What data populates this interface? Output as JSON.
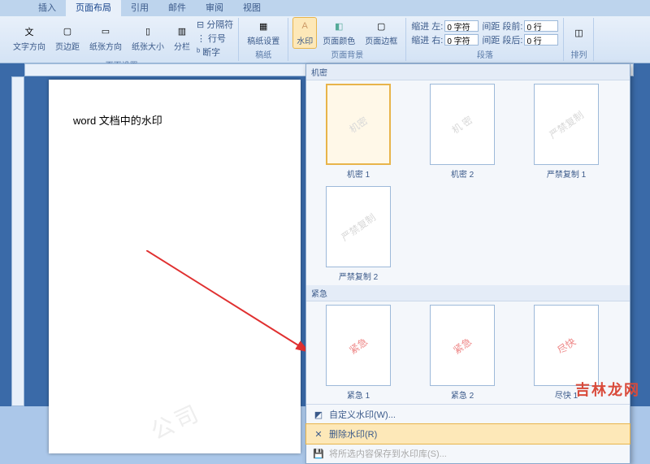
{
  "tabs": {
    "t1": "插入",
    "t2": "页面布局",
    "t3": "引用",
    "t4": "邮件",
    "t5": "审阅",
    "t6": "视图"
  },
  "ribbon": {
    "pageSetup": {
      "label": "页面设置",
      "textDir": "文字方向",
      "margins": "页边距",
      "orient": "纸张方向",
      "size": "纸张大小",
      "columns": "分栏",
      "breaks": "分隔符",
      "lineNum": "行号",
      "hyphen": "断字"
    },
    "paper": {
      "label": "稿纸",
      "btn": "稿纸设置"
    },
    "pageBg": {
      "label": "页面背景",
      "watermark": "水印",
      "pageColor": "页面颜色",
      "borders": "页面边框"
    },
    "paragraph": {
      "label": "段落",
      "indentL": "缩进 左:",
      "indentR": "缩进 右:",
      "spaceB": "间距 段前:",
      "spaceA": "间距 段后:",
      "zeroChar": "0 字符",
      "zeroLine": "0 行"
    },
    "arrange": {
      "label": "排列"
    }
  },
  "doc": {
    "text": "word 文档中的水印",
    "pageWm": "公司"
  },
  "gallery": {
    "sec1": "机密",
    "items1": [
      {
        "wm": "机密",
        "cap": "机密 1"
      },
      {
        "wm": "机 密",
        "cap": "机密 2"
      },
      {
        "wm": "严禁复制",
        "cap": "严禁复制 1"
      },
      {
        "wm": "严禁复制",
        "cap": "严禁复制 2"
      }
    ],
    "sec2": "紧急",
    "items2": [
      {
        "wm": "紧急",
        "cap": "紧急 1"
      },
      {
        "wm": "紧急",
        "cap": "紧急 2"
      },
      {
        "wm": "尽快",
        "cap": "尽快 1"
      }
    ],
    "custom": "自定义水印(W)...",
    "remove": "删除水印(R)",
    "save": "将所选内容保存到水印库(S)..."
  },
  "site": "吉林龙网"
}
